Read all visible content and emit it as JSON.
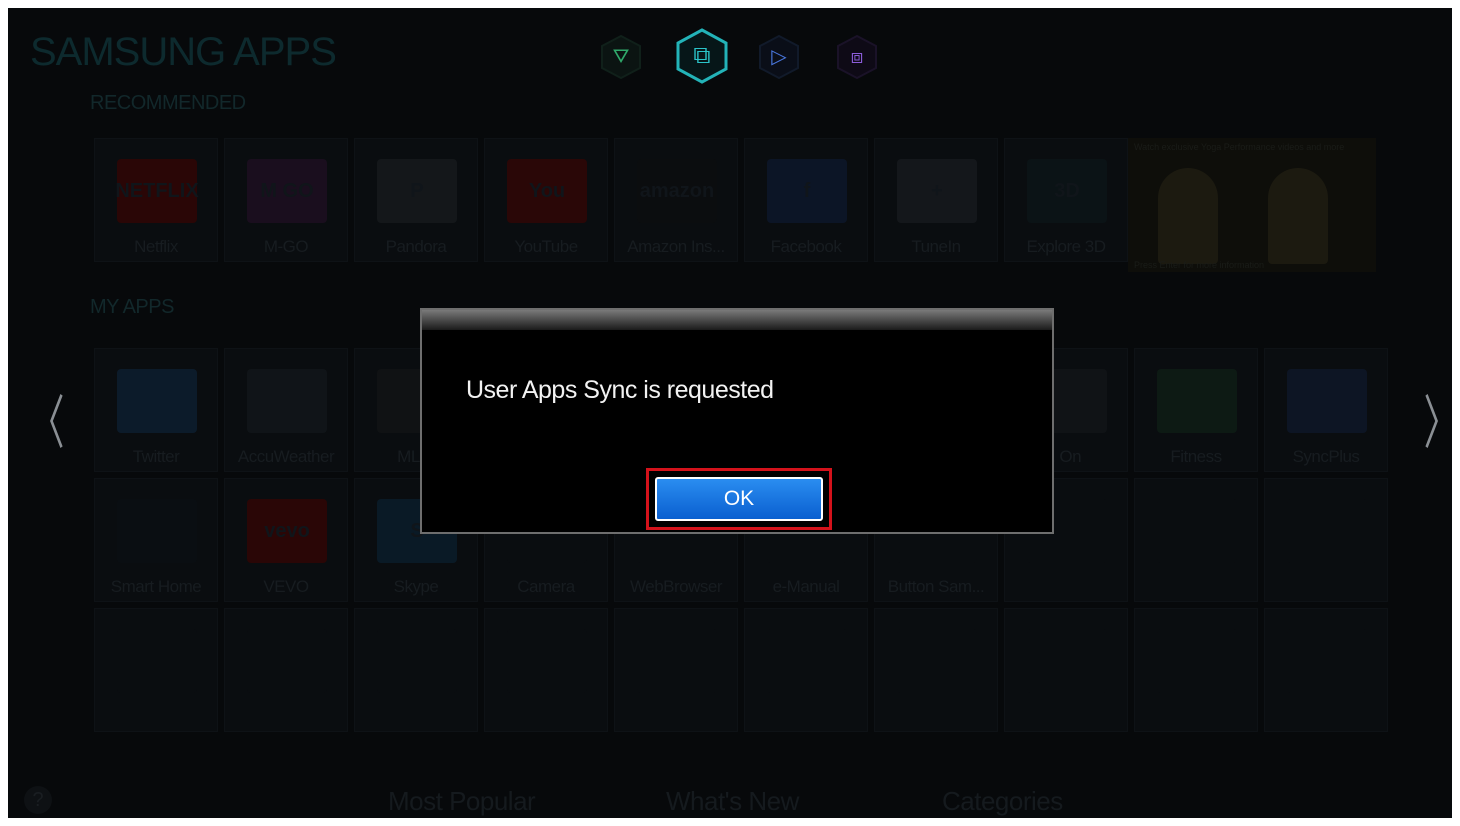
{
  "header": {
    "brand": "SAMSUNG APPS",
    "nav_icons": [
      {
        "name": "games-icon",
        "color": "#2fa86a",
        "glyph": "⛛"
      },
      {
        "name": "apps-icon",
        "color": "#2bc4c9",
        "glyph": "⧉"
      },
      {
        "name": "play-icon",
        "color": "#4a78e0",
        "glyph": "▷"
      },
      {
        "name": "media-icon",
        "color": "#8a5cd8",
        "glyph": "⧈"
      }
    ]
  },
  "recommended": {
    "label": "RECOMMENDED",
    "apps": [
      {
        "label": "Netflix",
        "color": "#2a0606",
        "text": "NETFLIX"
      },
      {
        "label": "M-GO",
        "color": "#1a0e1e",
        "text": "M GO"
      },
      {
        "label": "Pandora",
        "color": "#14171a",
        "text": "P"
      },
      {
        "label": "YouTube",
        "color": "#2a0707",
        "text": "You"
      },
      {
        "label": "Amazon Ins...",
        "color": "#0b0d0f",
        "text": "amazon"
      },
      {
        "label": "Facebook",
        "color": "#0c1526",
        "text": "f"
      },
      {
        "label": "TuneIn",
        "color": "#14171b",
        "text": "+"
      },
      {
        "label": "Explore 3D",
        "color": "#0b1316",
        "text": "3D"
      }
    ],
    "promo_text": "Watch exclusive Yoga Performance videos and more",
    "promo_footer": "Press Enter for more information"
  },
  "my_apps": {
    "label": "MY APPS",
    "row1": [
      {
        "label": "Twitter",
        "color": "#0c1b2a",
        "text": ""
      },
      {
        "label": "AccuWeather",
        "color": "#101418",
        "text": ""
      },
      {
        "label": "MLB.",
        "color": "#101214",
        "text": ""
      },
      {
        "label": "",
        "color": "#0a0d10",
        "text": ""
      },
      {
        "label": "",
        "color": "#0a0d10",
        "text": ""
      },
      {
        "label": "",
        "color": "#0a0d10",
        "text": ""
      },
      {
        "label": "",
        "color": "#0a0d10",
        "text": ""
      },
      {
        "label": ". On",
        "color": "#101316",
        "text": ""
      },
      {
        "label": "Fitness",
        "color": "#0d1a14",
        "text": ""
      },
      {
        "label": "SyncPlus",
        "color": "#0d1524",
        "text": ""
      }
    ],
    "row2": [
      {
        "label": "Smart Home",
        "color": "#0a0e12",
        "text": ""
      },
      {
        "label": "VEVO",
        "color": "#2a0606",
        "text": "vevo"
      },
      {
        "label": "Skype",
        "color": "#0a1a26",
        "text": "S"
      },
      {
        "label": "Camera",
        "color": "#0a0d10",
        "text": ""
      },
      {
        "label": "WebBrowser",
        "color": "#0a0d10",
        "text": ""
      },
      {
        "label": "e-Manual",
        "color": "#0a0d10",
        "text": ""
      },
      {
        "label": "Button Sam...",
        "color": "#0a0d10",
        "text": ""
      }
    ]
  },
  "bottom_tabs": [
    "Most Popular",
    "What's New",
    "Categories"
  ],
  "help_label": "?",
  "arrows": {
    "left": "〈",
    "right": "〉"
  },
  "dialog": {
    "message": "User Apps Sync is requested",
    "ok_label": "OK"
  },
  "colors": {
    "highlight": "#d4121b",
    "ok_button": "#1a7ae6"
  }
}
